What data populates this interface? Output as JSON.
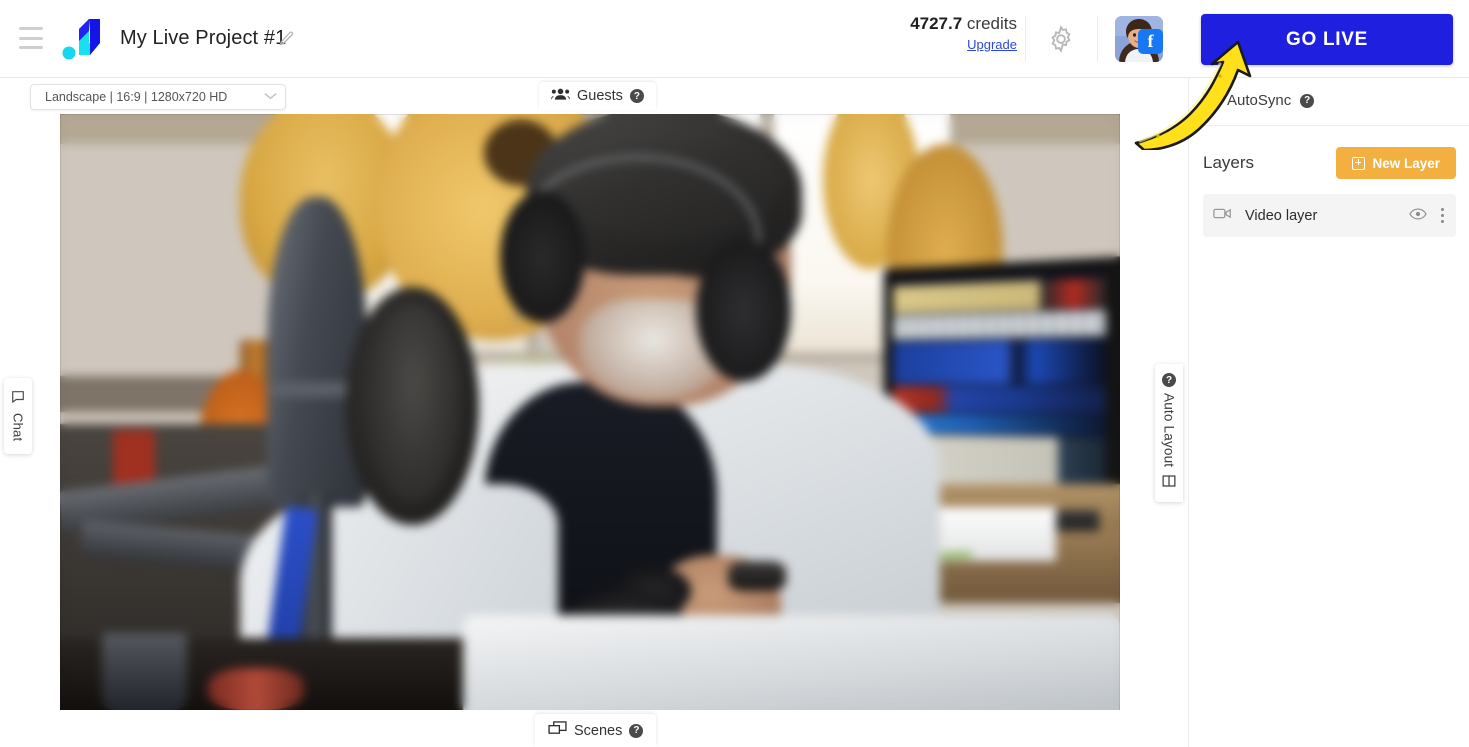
{
  "header": {
    "menu_icon": "hamburger-icon",
    "logo_icon": "brand-logo-icon",
    "project_title": "My Live Project #1",
    "edit_icon": "pencil-icon",
    "credits_value": "4727.7",
    "credits_label": "credits",
    "upgrade_label": "Upgrade",
    "settings_icon": "gear-icon",
    "avatar_icon": "user-avatar",
    "avatar_badge": "f",
    "go_live_label": "GO LIVE",
    "go_live_color": "#1f1fe0"
  },
  "toolbar": {
    "format_value": "Landscape | 16:9 | 1280x720 HD",
    "format_caret": "chevron-down-icon",
    "guests_label": "Guests",
    "guests_icon": "people-icon",
    "guests_help": "?"
  },
  "stage": {
    "chat_tab_label": "Chat",
    "chat_tab_icon": "chat-bubble-icon",
    "auto_layout_label": "Auto Layout",
    "auto_layout_icon": "layout-grid-icon",
    "auto_layout_help": "?",
    "scenes_label": "Scenes",
    "scenes_icon": "scenes-icon",
    "scenes_help": "?"
  },
  "right_panel": {
    "autosync_label": "AutoSync",
    "autosync_help": "?",
    "autosync_checked": false,
    "layers_title": "Layers",
    "new_layer_label": "New Layer",
    "new_layer_color": "#f3b041",
    "layers": [
      {
        "name": "Video layer",
        "type_icon": "video-camera-icon",
        "visibility_icon": "eye-icon",
        "menu_icon": "kebab-menu-icon"
      }
    ]
  },
  "annotation": {
    "arrow_icon": "curved-arrow-up-icon",
    "arrow_color": "#ffe01a",
    "arrow_outline": "#1a1a1a"
  }
}
